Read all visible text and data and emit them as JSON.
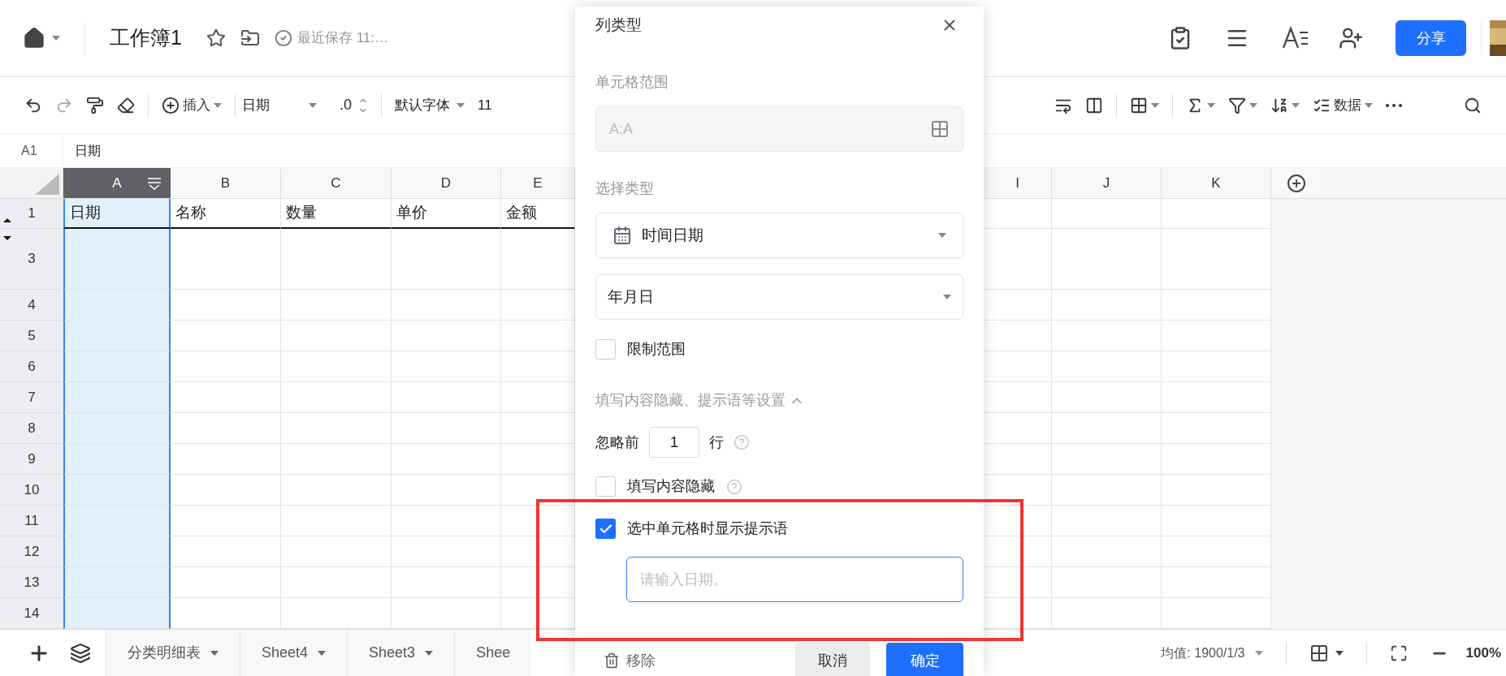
{
  "topbar": {
    "title": "工作簿1",
    "save_status": "最近保存 11:…",
    "share": "分享"
  },
  "toolbar": {
    "insert": "插入",
    "number_format": "日期",
    "decimal": ".0",
    "font": "默认字体",
    "font_size": "11",
    "data": "数据"
  },
  "formula_bar": {
    "cell_ref": "A1",
    "content": "日期"
  },
  "columns": [
    {
      "label": "A",
      "selected": true
    },
    {
      "label": "B",
      "selected": false
    },
    {
      "label": "C",
      "selected": false
    },
    {
      "label": "D",
      "selected": false
    },
    {
      "label": "E",
      "selected": false
    },
    {
      "label": "I",
      "selected": false
    },
    {
      "label": "J",
      "selected": false
    },
    {
      "label": "K",
      "selected": false
    }
  ],
  "rows": [
    {
      "label": "1",
      "cells": [
        "日期",
        "名称",
        "数量",
        "单价",
        "金额"
      ]
    },
    {
      "label": "3"
    },
    {
      "label": "4"
    },
    {
      "label": "5"
    },
    {
      "label": "6"
    },
    {
      "label": "7"
    },
    {
      "label": "8"
    },
    {
      "label": "9"
    },
    {
      "label": "10"
    },
    {
      "label": "11"
    },
    {
      "label": "12"
    },
    {
      "label": "13"
    },
    {
      "label": "14"
    }
  ],
  "dialog": {
    "title": "列类型",
    "range_label": "单元格范围",
    "range_value": "A:A",
    "type_label": "选择类型",
    "type_select": "时间日期",
    "format_select": "年月日",
    "limit_range": {
      "label": "限制范围",
      "checked": false
    },
    "section": {
      "label": "填写内容隐藏、提示语等设置",
      "expanded": true
    },
    "skip_rows": {
      "prefix": "忽略前",
      "value": "1",
      "suffix": "行"
    },
    "hide_content": {
      "label": "填写内容隐藏",
      "checked": false
    },
    "show_hint": {
      "label": "选中单元格时显示提示语",
      "checked": true
    },
    "hint_input": {
      "placeholder": "请输入日期。"
    },
    "remove": "移除",
    "cancel": "取消",
    "confirm": "确定"
  },
  "sheet_tabs": [
    {
      "label": "分类明细表"
    },
    {
      "label": "Sheet4"
    },
    {
      "label": "Sheet3"
    },
    {
      "label": "Shee"
    }
  ],
  "status": {
    "average": "均值: 1900/1/3",
    "zoom": "100%"
  }
}
